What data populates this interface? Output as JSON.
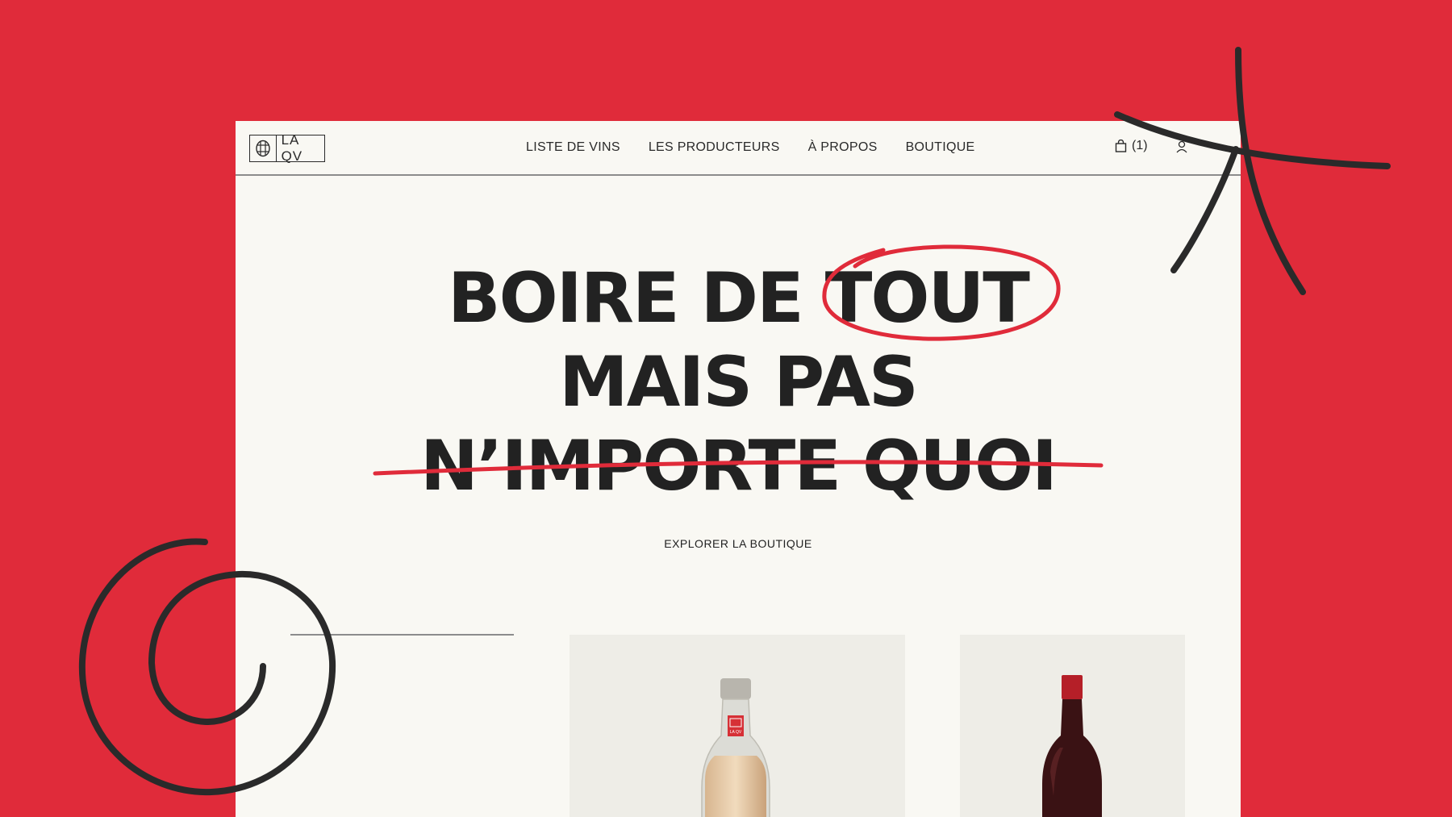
{
  "nav": {
    "logo_text": "LA QV",
    "menu": [
      "LISTE DE VINS",
      "LES PRODUCTEURS",
      "À PROPOS",
      "BOUTIQUE"
    ],
    "cart_count": "(1)"
  },
  "hero": {
    "line1a": "BOIRE DE",
    "line1b": "TOUT",
    "line2": "MAIS PAS",
    "line3": "N’IMPORTE QUOI",
    "cta": "EXPLORER LA BOUTIQUE"
  },
  "bottle_label": "LA QV",
  "colors": {
    "brand_red": "#e02b3a",
    "ink": "#2a2a2a",
    "paper": "#f9f8f3"
  }
}
